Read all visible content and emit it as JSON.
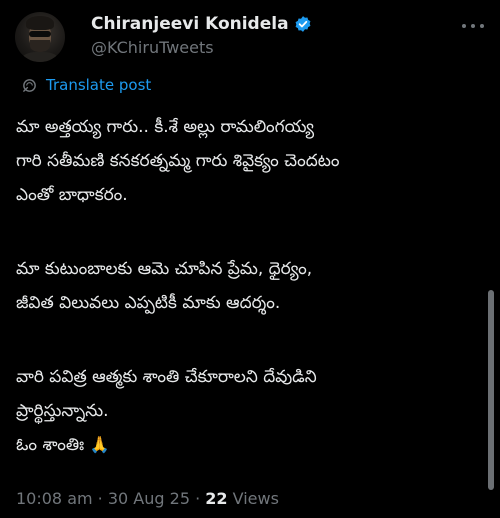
{
  "author": {
    "display_name": "Chiranjeevi Konidela",
    "handle": "@KChiruTweets",
    "verified_icon": "verified-badge-icon",
    "avatar_icon": "avatar"
  },
  "translate": {
    "label": "Translate post",
    "icon": "globe-translate-icon"
  },
  "post": {
    "p1_line1": "మా అత్తయ్య గారు.. కీ.శే అల్లు రామలింగయ్య",
    "p1_line2": "గారి సతీమణి కనకరత్నమ్మ గారు శివైక్యం చెందటం",
    "p1_line3": "ఎంతో బాధాకరం.",
    "p2_line1": "మా కుటుంబాలకు ఆమె చూపిన ప్రేమ, ధైర్యం,",
    "p2_line2": "జీవిత విలువలు ఎప్పటికీ మాకు ఆదర్శం.",
    "p3_line1": "వారి పవిత్ర ఆత్మకు శాంతి చేకూరాలని దేవుడిని",
    "p3_line2": "ప్రార్థిస్తున్నాను.",
    "p3_line3": "ఓం శాంతిః",
    "emoji": "🙏"
  },
  "meta": {
    "time": "10:08 am",
    "separator": " · ",
    "date": "30 Aug 25",
    "views_count": "22",
    "views_label": " Views"
  },
  "colors": {
    "background": "#000000",
    "text_primary": "#e7e9ea",
    "text_secondary": "#71767b",
    "accent": "#1d9bf0"
  }
}
